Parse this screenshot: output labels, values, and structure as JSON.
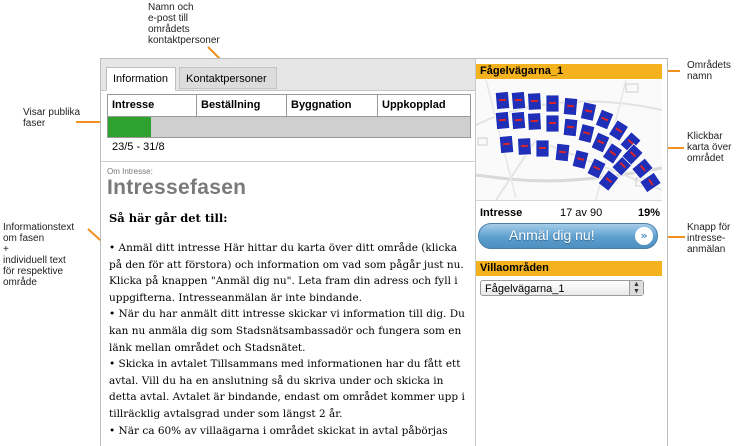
{
  "annotations": {
    "contacts": "Namn och\ne-post till\nområdets\nkontaktpersoner",
    "area_name": "Områdets\nnamn",
    "public_phases": "Visar publika\nfaser",
    "map": "Klickbar\nkarta över\nområdet",
    "info_text": "Informationstext\nom fasen\n+\nindividuell text\nför respektive\nområde",
    "apply_button": "Knapp för\nintresse-\nanmälan"
  },
  "tabs": [
    {
      "label": "Information",
      "active": true
    },
    {
      "label": "Kontaktpersoner",
      "active": false
    }
  ],
  "phases": {
    "labels": [
      "Intresse",
      "Beställning",
      "Byggnation",
      "Uppkopplad"
    ],
    "progress_fraction": 0.12,
    "fill_color": "#2ea12e",
    "dates": "23/5 - 31/8"
  },
  "content": {
    "section_label": "Om Intresse:",
    "title": "Intressefasen",
    "how_title": "Så här går det till:",
    "paragraphs": [
      "•  Anmäl ditt intresse Här hittar du karta över ditt område (klicka på den för att förstora) och information om vad som pågår just nu. Klicka på knappen \"Anmäl dig nu\". Leta fram din adress och fyll i uppgifterna. Intresseanmälan är inte bindande.",
      "•  När du har anmält ditt intresse skickar vi information till dig. Du kan nu anmäla dig som Stadsnätsambassadör och fungera som en länk mellan området och Stadsnätet.",
      "•  Skicka in avtalet Tillsammans med informationen har du fått ett avtal. Vill du ha en anslutning så du skriva under och skicka in detta avtal. Avtalet är bindande, endast om området kommer upp i tillräcklig avtalsgrad under som längst 2 år.",
      "•  När ca 60% av villaägarna i området skickat in avtal påbörjas"
    ]
  },
  "area": {
    "name": "Fågelvägarna_1",
    "stats_label": "Intresse",
    "count": "17  av 90",
    "percent": "19%",
    "apply_label": "Anmäl dig nu!",
    "apply_chevron": "»",
    "villa_header": "Villaområden",
    "villa_selected": "Fågelvägarna_1",
    "select_arrows": "▲\n▼"
  },
  "colors": {
    "header_bar": "#f4b21f",
    "accent_arrow": "#f0901e",
    "plot_blue": "#1f2fb8",
    "plot_red": "#d8232a",
    "button_blue": "#5d9fce"
  }
}
